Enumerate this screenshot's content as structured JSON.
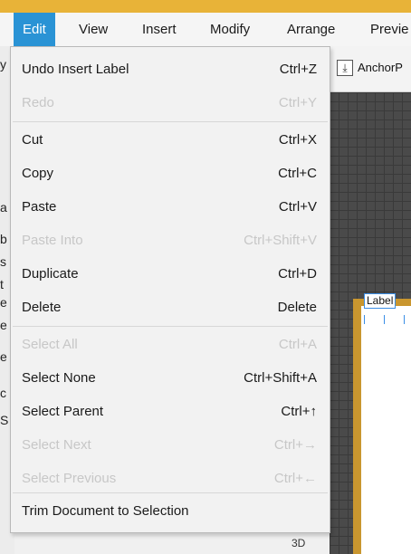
{
  "menubar": {
    "edit": "Edit",
    "view": "View",
    "insert": "Insert",
    "modify": "Modify",
    "arrange": "Arrange",
    "preview": "Previe"
  },
  "left_panel": [
    "y",
    "a",
    "b",
    "s",
    "t",
    "e",
    "e",
    "e",
    "c",
    "S"
  ],
  "edit_menu": {
    "items": [
      {
        "label": "Undo Insert Label",
        "shortcut": "Ctrl+Z",
        "enabled": true
      },
      {
        "label": "Redo",
        "shortcut": "Ctrl+Y",
        "enabled": false
      },
      {
        "label": "Cut",
        "shortcut": "Ctrl+X",
        "enabled": true
      },
      {
        "label": "Copy",
        "shortcut": "Ctrl+C",
        "enabled": true
      },
      {
        "label": "Paste",
        "shortcut": "Ctrl+V",
        "enabled": true
      },
      {
        "label": "Paste Into",
        "shortcut": "Ctrl+Shift+V",
        "enabled": false
      },
      {
        "label": "Duplicate",
        "shortcut": "Ctrl+D",
        "enabled": true
      },
      {
        "label": "Delete",
        "shortcut": "Delete",
        "enabled": true
      },
      {
        "label": "Select All",
        "shortcut": "Ctrl+A",
        "enabled": false
      },
      {
        "label": "Select None",
        "shortcut": "Ctrl+Shift+A",
        "enabled": true
      },
      {
        "label": "Select Parent",
        "shortcut": "Ctrl+↑",
        "enabled": true
      },
      {
        "label": "Select Next",
        "shortcut": "Ctrl+→",
        "enabled": false
      },
      {
        "label": "Select Previous",
        "shortcut": "Ctrl+←",
        "enabled": false
      },
      {
        "label": "Trim Document to Selection",
        "shortcut": "",
        "enabled": true
      }
    ]
  },
  "toolbar": {
    "anchor_label": "AnchorP",
    "anchor_icon": "anchor-pane-icon"
  },
  "canvas": {
    "label_widget": "Label",
    "view_3d": "3D"
  },
  "colors": {
    "accent": "#2a93d5",
    "disabled_text": "#c7c7c7",
    "titlebar": "#e8b338",
    "artboard_border": "#c9962f"
  }
}
